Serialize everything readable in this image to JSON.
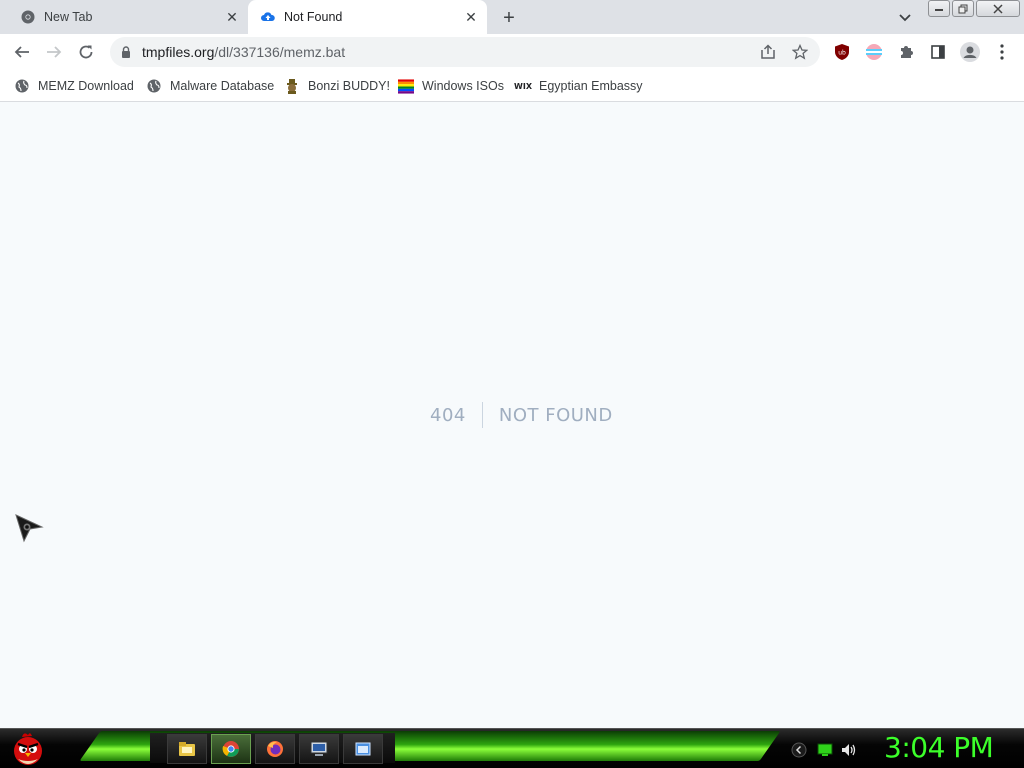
{
  "tabs": [
    {
      "title": "New Tab",
      "active": false
    },
    {
      "title": "Not Found",
      "active": true
    }
  ],
  "toolbar": {
    "url_host": "tmpfiles.org",
    "url_path": "/dl/337136/memz.bat"
  },
  "bookmarks": [
    {
      "label": "MEMZ Download",
      "icon": "globe-icon"
    },
    {
      "label": "Malware Database",
      "icon": "globe-icon"
    },
    {
      "label": "Bonzi BUDDY!",
      "icon": "bonzi-icon"
    },
    {
      "label": "Windows ISOs",
      "icon": "rainbow-flag-icon"
    },
    {
      "label": "Egyptian Embassy",
      "icon": "wix-icon"
    }
  ],
  "page": {
    "code": "404",
    "message": "NOT FOUND"
  },
  "taskbar": {
    "clock": "3:04 PM",
    "apps": [
      "file-explorer-icon",
      "chrome-icon",
      "firefox-icon",
      "computer-icon",
      "window-icon"
    ]
  },
  "colors": {
    "content_bg": "#f7fafc",
    "error_text": "#a0aec0",
    "clock": "#3cff2a"
  }
}
